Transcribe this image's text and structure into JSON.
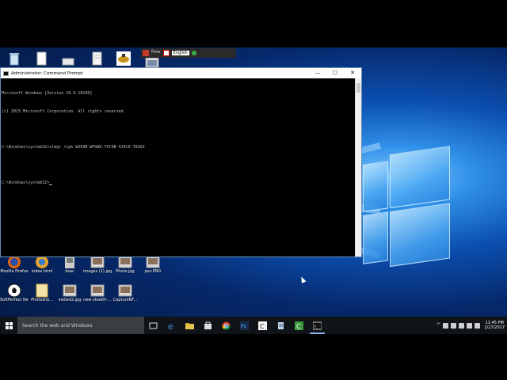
{
  "cmd_window": {
    "title": "Administrator: Command Prompt",
    "lines": [
      "Microsoft Windows [Version 10.0.10240]",
      "(c) 2015 Microsoft Corporation. All rights reserved.",
      "",
      "C:\\Windows\\system32>slmgr /ipk W269N-WFGWX-YVC9B-4J6C9-T83GX",
      "",
      "C:\\Windows\\system32>"
    ],
    "minimize_glyph": "—",
    "maximize_glyph": "☐",
    "close_glyph": "✕"
  },
  "language_bar": {
    "left_label": "বিজয়",
    "language": "English"
  },
  "desktop_row1": [
    {
      "label": "Mozilla Firefox",
      "icon": "firefox-icon"
    },
    {
      "label": "index.html",
      "icon": "html-file-icon"
    },
    {
      "label": "dsac",
      "icon": "file-icon"
    },
    {
      "label": "images (1).jpg",
      "icon": "image-icon"
    },
    {
      "label": "Photo.jpg",
      "icon": "image-icon"
    },
    {
      "label": "pov.PNG",
      "icon": "image-icon"
    }
  ],
  "desktop_row2": [
    {
      "label": "SoftPerfect Network...",
      "icon": "soccer-ball-icon"
    },
    {
      "label": "Photosho...",
      "icon": "folder-icon"
    },
    {
      "label": "vedwd2.jpg",
      "icon": "image-icon"
    },
    {
      "label": "new-stealth-...",
      "icon": "image-icon"
    },
    {
      "label": "CaptureNF...",
      "icon": "image-icon"
    }
  ],
  "taskbar": {
    "search_placeholder": "Search the web and Windows",
    "time": "11:45 PM",
    "date": "1/27/2017"
  },
  "colors": {
    "taskbar": "#101418",
    "console_text": "#c0c0c0",
    "desktop_accent": "#2f8fe8"
  }
}
